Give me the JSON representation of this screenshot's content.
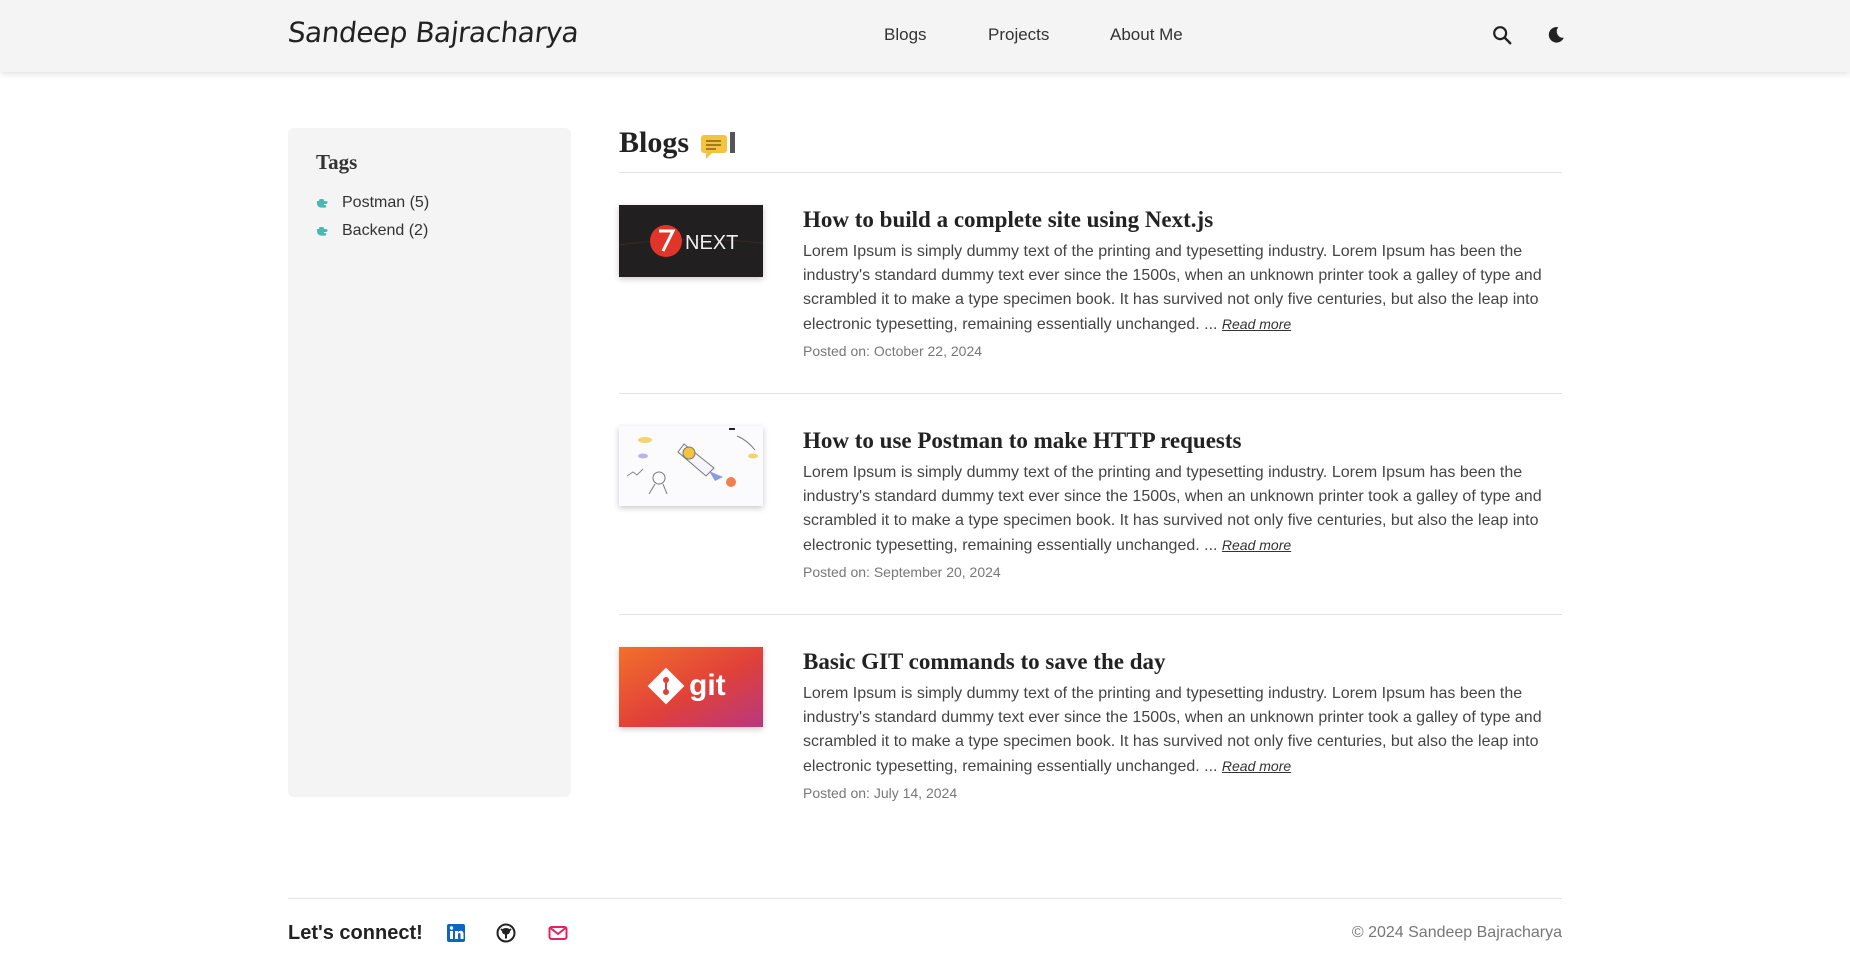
{
  "header": {
    "brand": "Sandeep Bajracharya",
    "nav": [
      "Blogs",
      "Projects",
      "About Me"
    ]
  },
  "sidebar": {
    "title": "Tags",
    "tags": [
      "Postman (5)",
      "Backend (2)"
    ]
  },
  "main": {
    "title": "Blogs",
    "posts": [
      {
        "title": "How to build a complete site using Next.js",
        "excerpt": "Lorem Ipsum is simply dummy text of the printing and typesetting industry. Lorem Ipsum has been the industry's standard dummy text ever since the 1500s, when an unknown printer took a galley of type and scrambled it to make a type specimen book. It has survived not only five centuries, but also the leap into electronic typesetting, remaining essentially unchanged. ... ",
        "read_more": "Read more",
        "date": "Posted on: October 22, 2024",
        "thumb_text": "NEXT"
      },
      {
        "title": "How to use Postman to make HTTP requests",
        "excerpt": "Lorem Ipsum is simply dummy text of the printing and typesetting industry. Lorem Ipsum has been the industry's standard dummy text ever since the 1500s, when an unknown printer took a galley of type and scrambled it to make a type specimen book. It has survived not only five centuries, but also the leap into electronic typesetting, remaining essentially unchanged. ... ",
        "read_more": "Read more",
        "date": "Posted on: September 20, 2024"
      },
      {
        "title": "Basic GIT commands to save the day",
        "excerpt": "Lorem Ipsum is simply dummy text of the printing and typesetting industry. Lorem Ipsum has been the industry's standard dummy text ever since the 1500s, when an unknown printer took a galley of type and scrambled it to make a type specimen book. It has survived not only five centuries, but also the leap into electronic typesetting, remaining essentially unchanged. ... ",
        "read_more": "Read more",
        "date": "Posted on: July 14, 2024",
        "thumb_text": "git"
      }
    ]
  },
  "footer": {
    "connect": "Let's connect!",
    "copyright": "© 2024 Sandeep Bajracharya"
  },
  "icons": {
    "search": "search-icon",
    "theme": "moon-icon",
    "tag": "pointing-hand-icon",
    "title_emoji": "memo-icon",
    "social": [
      "linkedin-icon",
      "github-icon",
      "mail-icon"
    ]
  },
  "colors": {
    "header_bg": "#f4f4f4",
    "sidebar_bg": "#f4f4f4",
    "linkedin": "#0a66c2",
    "mail": "#e0245e"
  }
}
